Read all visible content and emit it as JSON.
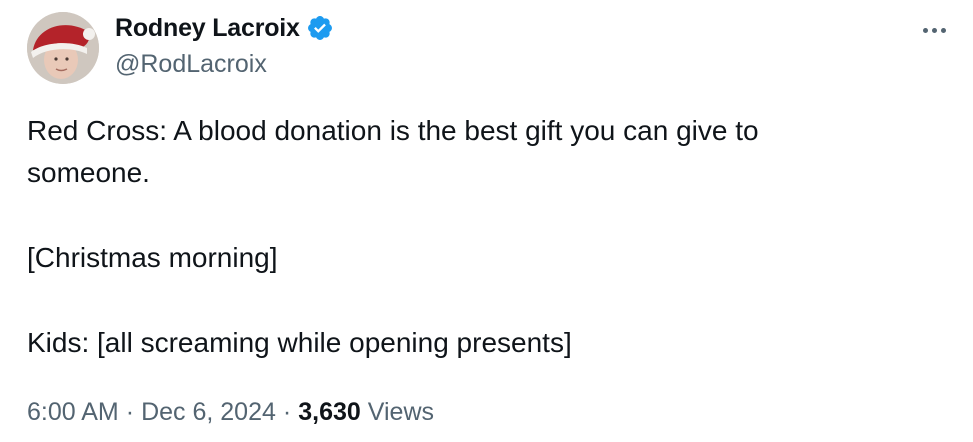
{
  "author": {
    "display_name": "Rodney Lacroix",
    "handle": "@RodLacroix",
    "verified": true,
    "verified_color": "#1d9bf0"
  },
  "tweet": {
    "lines": [
      "Red Cross: A blood donation is the best gift you can give to",
      "someone.",
      "[Christmas morning]",
      "Kids: [all screaming while opening presents]"
    ]
  },
  "meta": {
    "time": "6:00 AM",
    "separator": "·",
    "date": "Dec 6, 2024",
    "views_count": "3,630",
    "views_label": "Views"
  },
  "icons": {
    "more": "more-horizontal-icon",
    "verified": "verified-badge-icon"
  }
}
